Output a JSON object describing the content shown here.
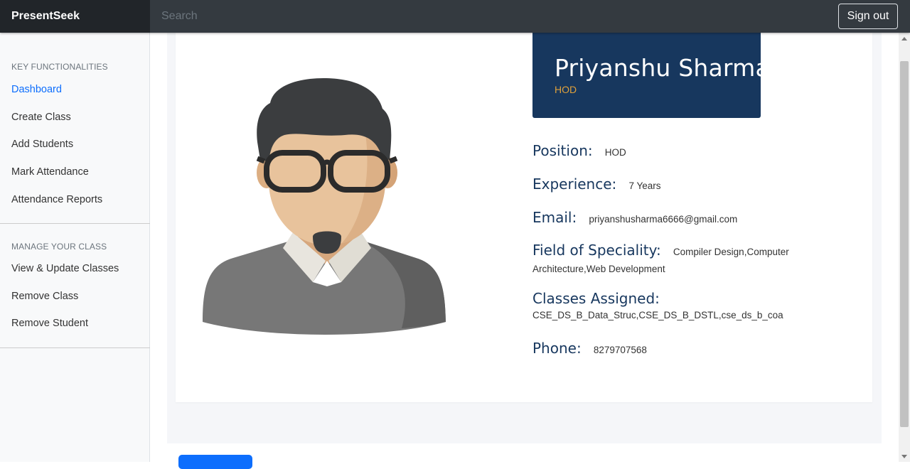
{
  "navbar": {
    "brand": "PresentSeek",
    "search_placeholder": "Search",
    "signout_label": "Sign out"
  },
  "sidebar": {
    "section1_heading": "KEY FUNCTIONALITIES",
    "section1_items": [
      "Dashboard",
      "Create Class",
      "Add Students",
      "Mark Attendance",
      "Attendance Reports"
    ],
    "section2_heading": "MANAGE YOUR CLASS",
    "section2_items": [
      "View & Update Classes",
      "Remove Class",
      "Remove Student"
    ]
  },
  "profile": {
    "name": "Priyanshu Sharma",
    "role": "HOD",
    "fields": [
      {
        "label": "Position:",
        "value": "HOD"
      },
      {
        "label": "Experience:",
        "value": "7 Years"
      },
      {
        "label": "Email:",
        "value": "priyanshusharma6666@gmail.com"
      },
      {
        "label": "Field of Speciality:",
        "value": "Compiler Design,Computer Architecture,Web Development"
      },
      {
        "label": "Classes Assigned:",
        "value": "CSE_DS_B_Data_Struc,CSE_DS_B_DSTL,cse_ds_b_coa"
      },
      {
        "label": "Phone:",
        "value": "8279707568"
      }
    ]
  },
  "colors": {
    "navbar": "#343a40",
    "brand_bg": "#212529",
    "name_box": "#17375e",
    "role_text": "#e0a13b",
    "active_link": "#0d6efd"
  },
  "icons": {
    "avatar": "user-avatar-illustration"
  }
}
